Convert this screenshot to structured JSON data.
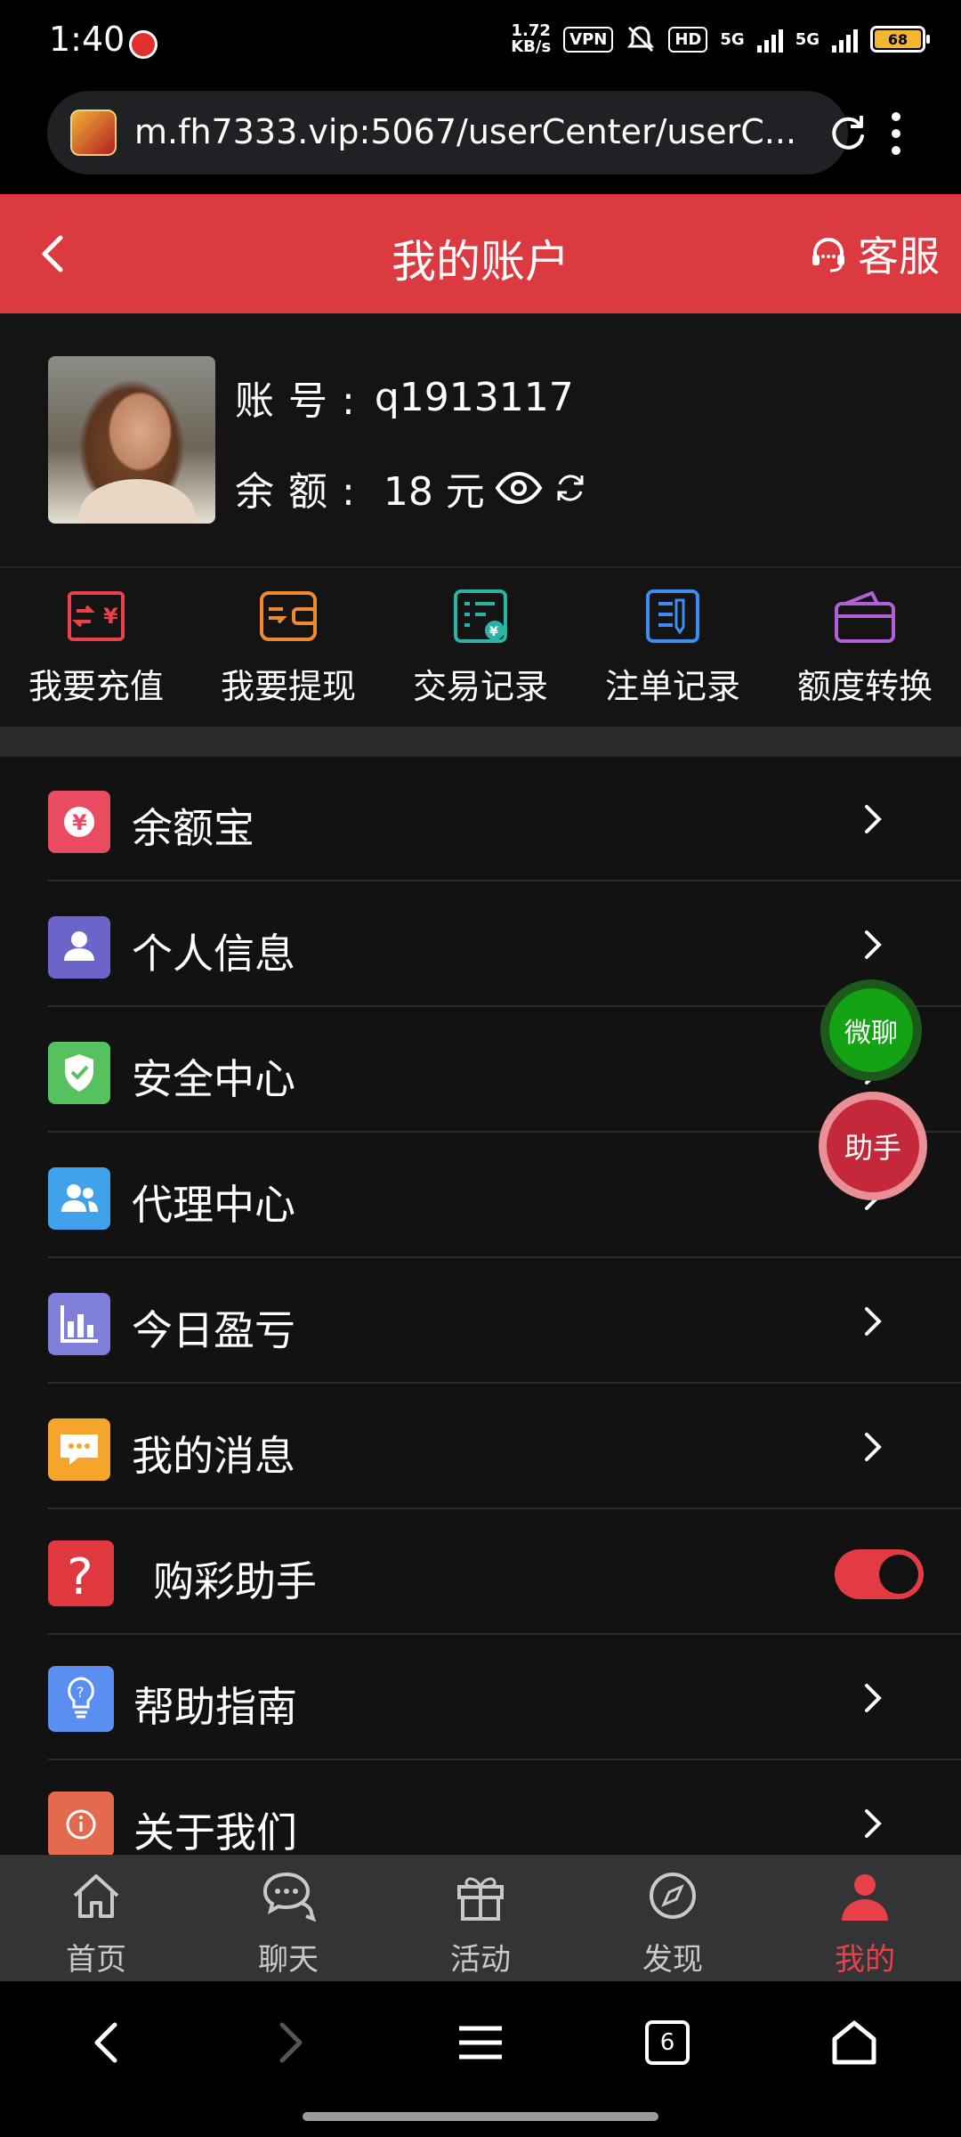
{
  "status_bar": {
    "time": "1:40",
    "net_speed_value": "1.72",
    "net_speed_unit": "KB/s",
    "vpn": "VPN",
    "hd": "HD",
    "net1": "5G",
    "net2": "5G",
    "battery": "68"
  },
  "browser": {
    "url": "m.fh7333.vip:5067/userCenter/userC...",
    "tab_count": "6"
  },
  "header": {
    "title": "我的账户",
    "service_label": "客服"
  },
  "account": {
    "username_label": "账号:",
    "username": "q1913117",
    "balance_label": "余额:",
    "balance": "18 元"
  },
  "actions": [
    {
      "label": "我要充值",
      "icon": "recharge-icon",
      "color": "#e8414a"
    },
    {
      "label": "我要提现",
      "icon": "withdraw-icon",
      "color": "#f08a2e"
    },
    {
      "label": "交易记录",
      "icon": "transaction-record-icon",
      "color": "#2bb3a3"
    },
    {
      "label": "注单记录",
      "icon": "bet-record-icon",
      "color": "#3f8df0"
    },
    {
      "label": "额度转换",
      "icon": "credit-transfer-icon",
      "color": "#b35fd6"
    }
  ],
  "menu": [
    {
      "label": "余额宝",
      "icon": "yuan-icon",
      "color": "#e94c61"
    },
    {
      "label": "个人信息",
      "icon": "person-icon",
      "color": "#6b64c9"
    },
    {
      "label": "安全中心",
      "icon": "shield-icon",
      "color": "#56c25f"
    },
    {
      "label": "代理中心",
      "icon": "agents-icon",
      "color": "#3fa2ea"
    },
    {
      "label": "今日盈亏",
      "icon": "bar-chart-icon",
      "color": "#7f7ed9"
    },
    {
      "label": "我的消息",
      "icon": "message-icon",
      "color": "#f5a52c"
    },
    {
      "label": "购彩助手",
      "icon": "question-icon",
      "color": "#e0383f",
      "toggle_on": true
    },
    {
      "label": "帮助指南",
      "icon": "lightbulb-icon",
      "color": "#5a8ef0"
    },
    {
      "label": "关于我们",
      "icon": "info-icon",
      "color": "#e36a4d"
    }
  ],
  "floating": {
    "chat": "微聊",
    "helper": "助手"
  },
  "tabs": [
    {
      "label": "首页",
      "icon": "home-icon"
    },
    {
      "label": "聊天",
      "icon": "chat-icon"
    },
    {
      "label": "活动",
      "icon": "gift-icon"
    },
    {
      "label": "发现",
      "icon": "compass-icon"
    },
    {
      "label": "我的",
      "icon": "user-icon",
      "active": true
    }
  ]
}
